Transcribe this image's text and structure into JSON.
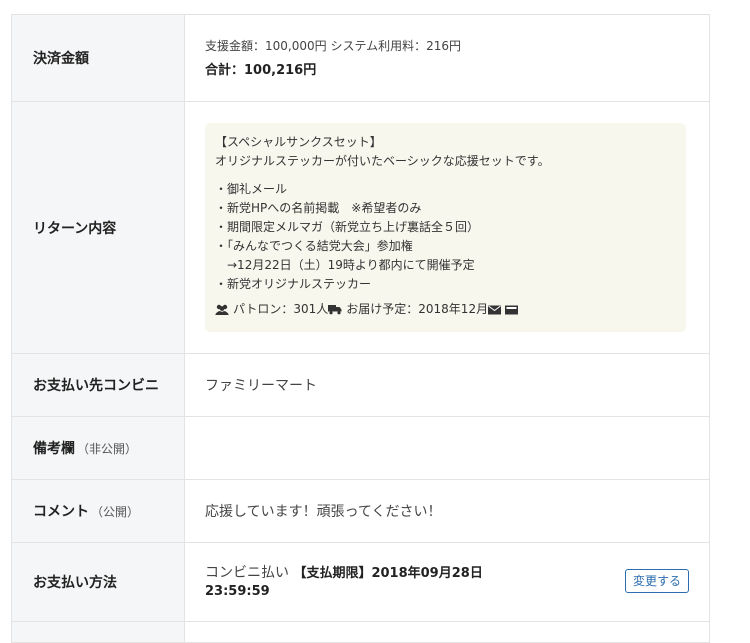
{
  "payment_amount": {
    "label": "決済金額",
    "breakdown": "支援金額：100,000円 システム利用料：216円",
    "total": "合計：100,216円"
  },
  "return": {
    "label": "リターン内容",
    "title": "【スペシャルサンクスセット】",
    "description": "オリジナルステッカーが付いたベーシックな応援セットです。",
    "items": [
      "・御礼メール",
      "・新党HPへの名前掲載　※希望者のみ",
      "・期間限定メルマガ（新党立ち上げ裏話全５回）",
      "・「みんなでつくる結党大会」参加権",
      "→12月22日（土）19時より都内にて開催予定",
      "・新党オリジナルステッカー"
    ],
    "patrons": "パトロン：301人",
    "delivery": "お届け予定：2018年12月",
    "icons": [
      "users-icon",
      "truck-icon",
      "envelope-icon"
    ]
  },
  "convenience_store": {
    "label": "お支払い先コンビニ",
    "value": "ファミリーマート"
  },
  "remarks": {
    "label": "備考欄",
    "label_sub": "（非公開）",
    "value": ""
  },
  "comment": {
    "label": "コメント",
    "label_sub": "（公開）",
    "value": "応援しています！頑張ってください！"
  },
  "payment_method": {
    "label": "お支払い方法",
    "method": "コンビニ払い",
    "deadline": "【支払期限】2018年09月28日",
    "deadline_time": "23:59:59",
    "change_button": "変更する"
  }
}
